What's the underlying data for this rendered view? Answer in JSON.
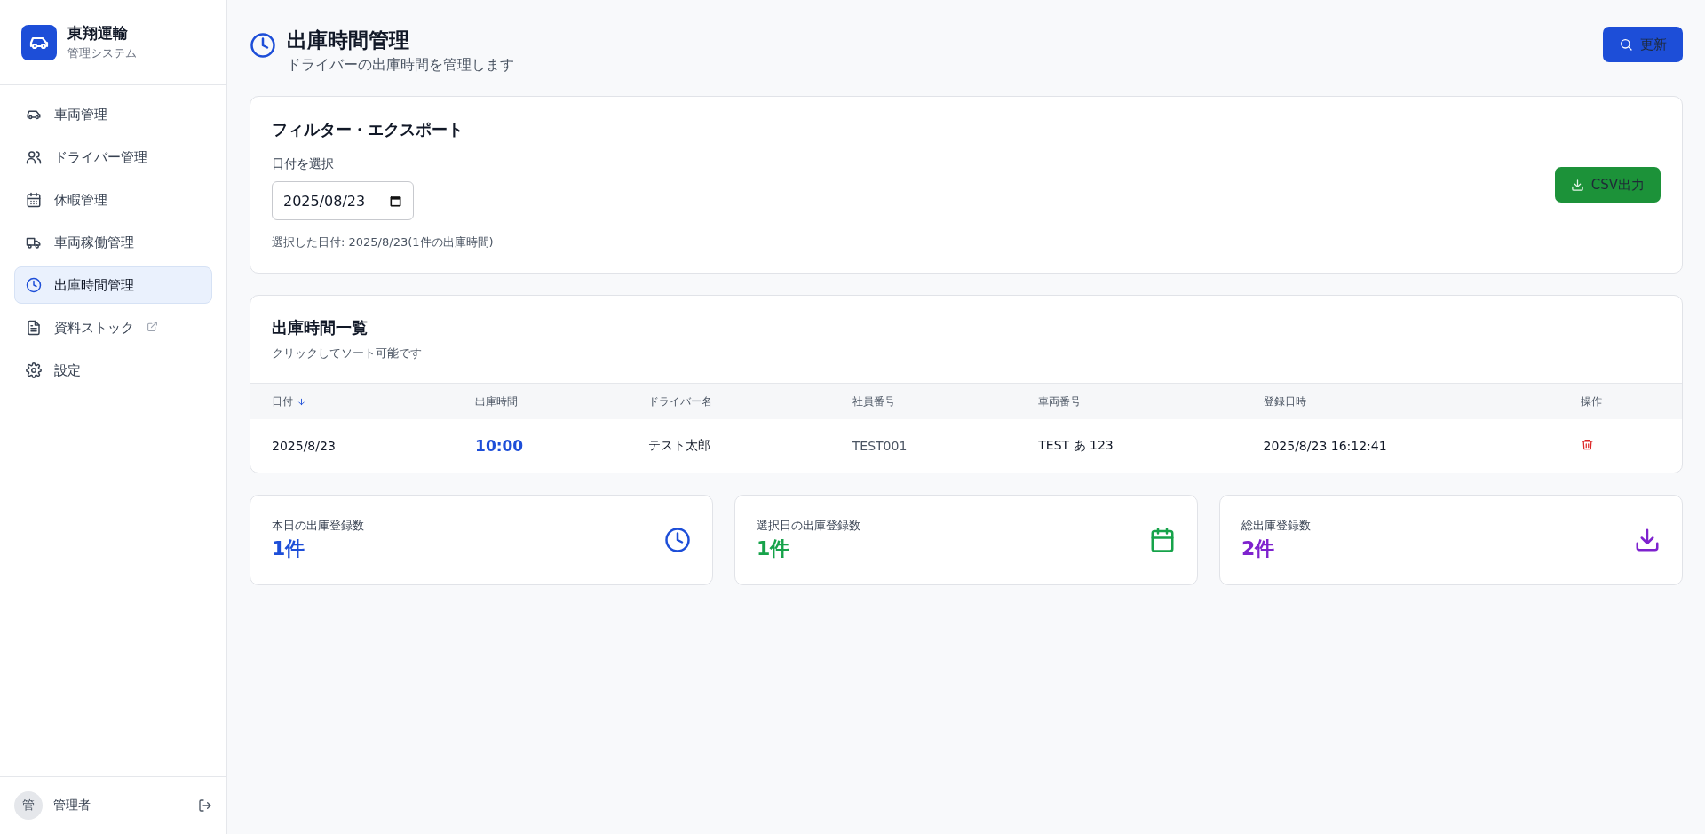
{
  "brand": {
    "name": "東翔運輸",
    "subtitle": "管理システム"
  },
  "sidebar": {
    "items": [
      {
        "label": "車両管理",
        "selected": false,
        "external": false
      },
      {
        "label": "ドライバー管理",
        "selected": false,
        "external": false
      },
      {
        "label": "休暇管理",
        "selected": false,
        "external": false
      },
      {
        "label": "車両稼働管理",
        "selected": false,
        "external": false
      },
      {
        "label": "出庫時間管理",
        "selected": true,
        "external": false
      },
      {
        "label": "資料ストック",
        "selected": false,
        "external": true
      },
      {
        "label": "設定",
        "selected": false,
        "external": false
      }
    ],
    "user": {
      "avatar": "管",
      "name": "管理者"
    }
  },
  "header": {
    "title": "出庫時間管理",
    "subtitle": "ドライバーの出庫時間を管理します",
    "refresh_button": "更新"
  },
  "filter": {
    "title": "フィルター・エクスポート",
    "date_label": "日付を選択",
    "date_value": "2025/08/23",
    "summary": "選択した日付: 2025/8/23(1件の出庫時間)",
    "csv_button": "CSV出力"
  },
  "table": {
    "title": "出庫時間一覧",
    "subtitle": "クリックしてソート可能です",
    "columns": [
      {
        "label": "日付",
        "kind": "text",
        "sorted": true
      },
      {
        "label": "出庫時間",
        "kind": "time",
        "sorted": false
      },
      {
        "label": "ドライバー名",
        "kind": "text",
        "sorted": false
      },
      {
        "label": "社員番号",
        "kind": "muted",
        "sorted": false
      },
      {
        "label": "車両番号",
        "kind": "text",
        "sorted": false
      },
      {
        "label": "登録日時",
        "kind": "text",
        "sorted": false
      },
      {
        "label": "操作",
        "kind": "action",
        "sorted": false
      }
    ],
    "rows": [
      [
        "2025/8/23",
        "10:00",
        "テスト太郎",
        "TEST001",
        "TEST あ 123",
        "2025/8/23 16:12:41"
      ]
    ]
  },
  "stats": [
    {
      "label": "本日の出庫登録数",
      "value": "1件",
      "color": "#1d4ed8"
    },
    {
      "label": "選択日の出庫登録数",
      "value": "1件",
      "color": "#16a34a"
    },
    {
      "label": "総出庫登録数",
      "value": "2件",
      "color": "#7e22ce"
    }
  ]
}
